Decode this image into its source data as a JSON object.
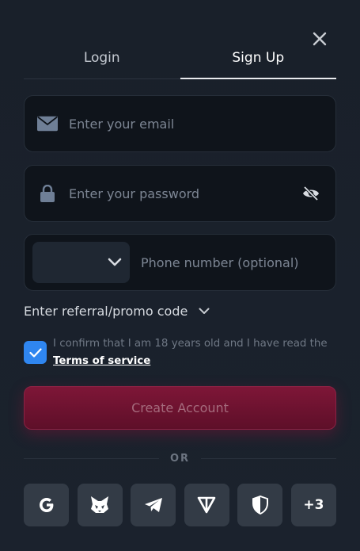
{
  "tabs": [
    {
      "label": "Login",
      "active": false
    },
    {
      "label": "Sign Up",
      "active": true
    }
  ],
  "email": {
    "placeholder": "Enter your email",
    "icon": "mail-icon"
  },
  "password": {
    "placeholder": "Enter your password",
    "icon": "lock-icon",
    "toggle_icon": "eye-off-icon"
  },
  "phone": {
    "placeholder": "Phone number (optional)",
    "country_selected": ""
  },
  "promo": {
    "label": "Enter referral/promo code"
  },
  "confirm": {
    "checked": true,
    "text": "I confirm that I am 18 years old and I have read the",
    "link": "Terms of service"
  },
  "create_button": "Create Account",
  "divider": "OR",
  "socials": [
    {
      "name": "google",
      "icon": "google-icon"
    },
    {
      "name": "metamask",
      "icon": "fox-icon"
    },
    {
      "name": "telegram",
      "icon": "telegram-icon"
    },
    {
      "name": "ton",
      "icon": "ton-icon"
    },
    {
      "name": "shield",
      "icon": "shield-icon"
    },
    {
      "name": "more",
      "label": "+3"
    }
  ],
  "colors": {
    "background": "#1a212b",
    "field": "#0f141b",
    "accent": "#2f86f0",
    "button": "#6e1330",
    "social": "#333b46"
  }
}
